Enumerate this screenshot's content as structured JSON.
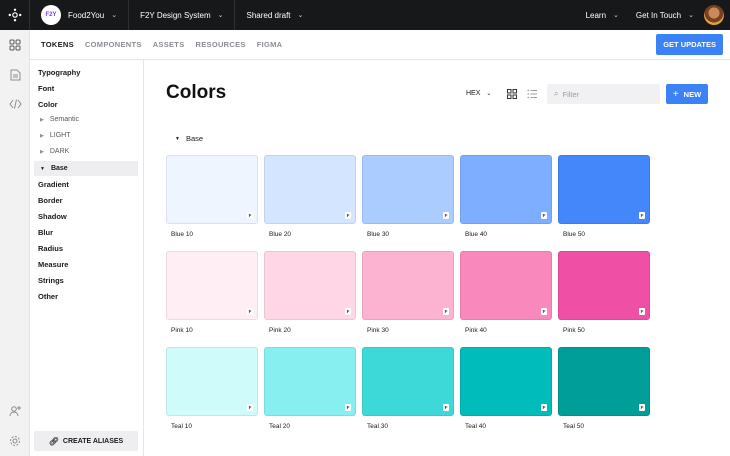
{
  "topbar": {
    "workspace_badge": "F2Y",
    "workspace_name": "Food2You",
    "project": "F2Y Design System",
    "draft": "Shared draft",
    "learn": "Learn",
    "get_in_touch": "Get In Touch"
  },
  "subnav": {
    "tabs": [
      "TOKENS",
      "COMPONENTS",
      "ASSETS",
      "RESOURCES",
      "FIGMA"
    ],
    "active_tab": "TOKENS",
    "get_updates": "GET UPDATES"
  },
  "sidebar": {
    "items": [
      "Typography",
      "Font",
      "Color",
      "Gradient",
      "Border",
      "Shadow",
      "Blur",
      "Radius",
      "Measure",
      "Strings",
      "Other"
    ],
    "color_children": [
      "Semantic",
      "LIGHT",
      "DARK",
      "Base"
    ],
    "active_child": "Base",
    "create_aliases": "CREATE ALIASES"
  },
  "main": {
    "title": "Colors",
    "format": "HEX",
    "filter_placeholder": "Filter",
    "new_button": "NEW",
    "section": "Base",
    "swatches": [
      {
        "name": "Blue 10",
        "color": "#eef5ff"
      },
      {
        "name": "Blue 20",
        "color": "#d4e5ff"
      },
      {
        "name": "Blue 30",
        "color": "#aaccff"
      },
      {
        "name": "Blue 40",
        "color": "#7eaeff"
      },
      {
        "name": "Blue 50",
        "color": "#4387fb"
      },
      {
        "name": "Pink 10",
        "color": "#ffeef4"
      },
      {
        "name": "Pink 20",
        "color": "#ffd6e5"
      },
      {
        "name": "Pink 30",
        "color": "#fbb3d1"
      },
      {
        "name": "Pink 40",
        "color": "#f988bc"
      },
      {
        "name": "Pink 50",
        "color": "#f04fa6"
      },
      {
        "name": "Teal 10",
        "color": "#cffbfa"
      },
      {
        "name": "Teal 20",
        "color": "#87efef"
      },
      {
        "name": "Teal 30",
        "color": "#3cd9d8"
      },
      {
        "name": "Teal 40",
        "color": "#00bcbb"
      },
      {
        "name": "Teal 50",
        "color": "#009e99"
      }
    ]
  },
  "colors": {
    "accent": "#3b82f6",
    "topbar_bg": "#17181a"
  }
}
